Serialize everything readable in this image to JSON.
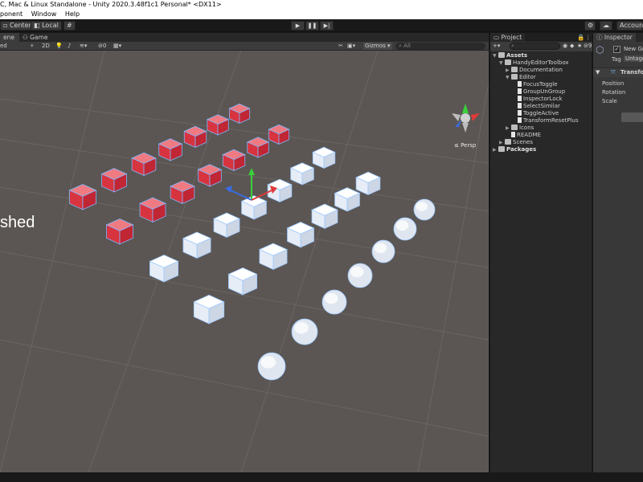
{
  "window": {
    "title": "C, Mac & Linux Standalone - Unity 2020.3.48f1c1 Personal* <DX11>"
  },
  "menu": [
    "ponent",
    "Window",
    "Help"
  ],
  "toolbar": {
    "center": "Center",
    "local": "Local",
    "account": "Account"
  },
  "scene": {
    "tabs": [
      "ene",
      "Game"
    ],
    "shading": "ed",
    "mode2d": "2D",
    "fx_count": "0",
    "gizmos": "Gizmos",
    "search_placeholder": "All",
    "overlay_text": "shed",
    "persp": "≤ Persp"
  },
  "project": {
    "tab": "Project",
    "hidden_count": "9",
    "tree": [
      {
        "label": "Assets",
        "depth": 0,
        "arrow": "▼",
        "icon": "folder",
        "bold": true
      },
      {
        "label": "HandyEditorToolbox",
        "depth": 1,
        "arrow": "▼",
        "icon": "folder",
        "bold": false
      },
      {
        "label": "Documentation",
        "depth": 2,
        "arrow": "▶",
        "icon": "folder",
        "bold": false
      },
      {
        "label": "Editor",
        "depth": 2,
        "arrow": "▼",
        "icon": "folder",
        "bold": false
      },
      {
        "label": "FocusToggle",
        "depth": 3,
        "arrow": "",
        "icon": "script",
        "bold": false
      },
      {
        "label": "GroupUnGroup",
        "depth": 3,
        "arrow": "",
        "icon": "script",
        "bold": false
      },
      {
        "label": "InspectorLock",
        "depth": 3,
        "arrow": "",
        "icon": "script",
        "bold": false
      },
      {
        "label": "SelectSimilar",
        "depth": 3,
        "arrow": "",
        "icon": "script",
        "bold": false
      },
      {
        "label": "ToggleActive",
        "depth": 3,
        "arrow": "",
        "icon": "script",
        "bold": false
      },
      {
        "label": "TransformResetPlus",
        "depth": 3,
        "arrow": "",
        "icon": "script",
        "bold": false
      },
      {
        "label": "Icons",
        "depth": 2,
        "arrow": "▶",
        "icon": "folder",
        "bold": false
      },
      {
        "label": "README",
        "depth": 2,
        "arrow": "",
        "icon": "script",
        "bold": false
      },
      {
        "label": "Scenes",
        "depth": 1,
        "arrow": "▶",
        "icon": "folder",
        "bold": false
      },
      {
        "label": "Packages",
        "depth": 0,
        "arrow": "▶",
        "icon": "folder",
        "bold": true
      }
    ]
  },
  "inspector": {
    "tab": "Inspector",
    "object_name": "New Gr",
    "tag_label": "Tag",
    "tag_value": "Untagg",
    "component": "Transform",
    "position": "Position",
    "rotation": "Rotation",
    "scale": "Scale"
  },
  "colors": {
    "scene_bg": "#5b5653",
    "red_cube": "#e0404a",
    "white_cube": "#eef3fb",
    "selection": "#6fb3ff"
  }
}
